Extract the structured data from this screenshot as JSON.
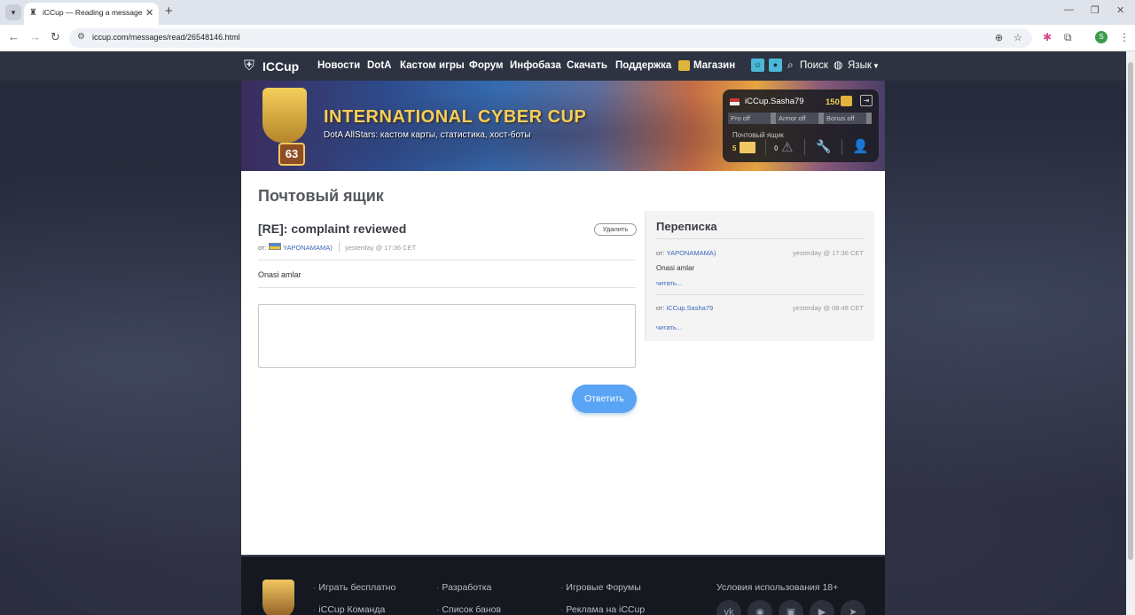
{
  "browser": {
    "tab_title": "iCCup — Reading a message fr",
    "url": "iccup.com/messages/read/26548146.html",
    "profile_initial": "S"
  },
  "nav": {
    "logo": "ICCup",
    "items": [
      "Новости",
      "DotA",
      "Кастом игры",
      "Форум",
      "Инфобаза",
      "Скачать",
      "Поддержка",
      "Магазин"
    ],
    "search": "Поиск",
    "language": "Язык"
  },
  "banner": {
    "title": "INTERNATIONAL CYBER CUP",
    "subtitle": "DotA AllStars: кастом карты, статистика, хост-боты",
    "badge": "63"
  },
  "user_panel": {
    "name": "iCCup.Sasha79",
    "gold": "150",
    "toggles": [
      "Pro off",
      "Armor off",
      "Bonus off"
    ],
    "mailbox_label": "Почтовый ящик",
    "mail_count": "5",
    "warn_count": "0"
  },
  "mailbox": {
    "page_title": "Почтовый ящик",
    "message": {
      "subject": "[RE]: complaint reviewed",
      "delete_label": "Удалить",
      "from_label": "от:",
      "from_user": "YAPONAMAMA)",
      "time": "yesterday @ 17:36 CET",
      "body": "Onasi amlar"
    },
    "reply_placeholder": "",
    "reply_button": "Ответить"
  },
  "conversation": {
    "title": "Переписка",
    "items": [
      {
        "from_label": "от:",
        "user": "YAPONAMAMA)",
        "time": "yesterday @ 17:36 CET",
        "body": "Onasi amlar",
        "read_label": "читать..."
      },
      {
        "from_label": "от:",
        "user": "iCCup.Sasha79",
        "time": "yesterday @ 08:48 CET",
        "body": "",
        "read_label": "читать..."
      }
    ]
  },
  "footer": {
    "col1": [
      "Играть бесплатно",
      "iCCup Команда"
    ],
    "col2": [
      "Разработка",
      "Список банов"
    ],
    "col3": [
      "Игровые Форумы",
      "Реклама на iCCup"
    ],
    "terms": "Условия использования 18+"
  },
  "colors": {
    "accent": "#5aa4f5",
    "link": "#3b67b8",
    "gold": "#f4cf5a",
    "nav_bg": "#2d3340"
  }
}
